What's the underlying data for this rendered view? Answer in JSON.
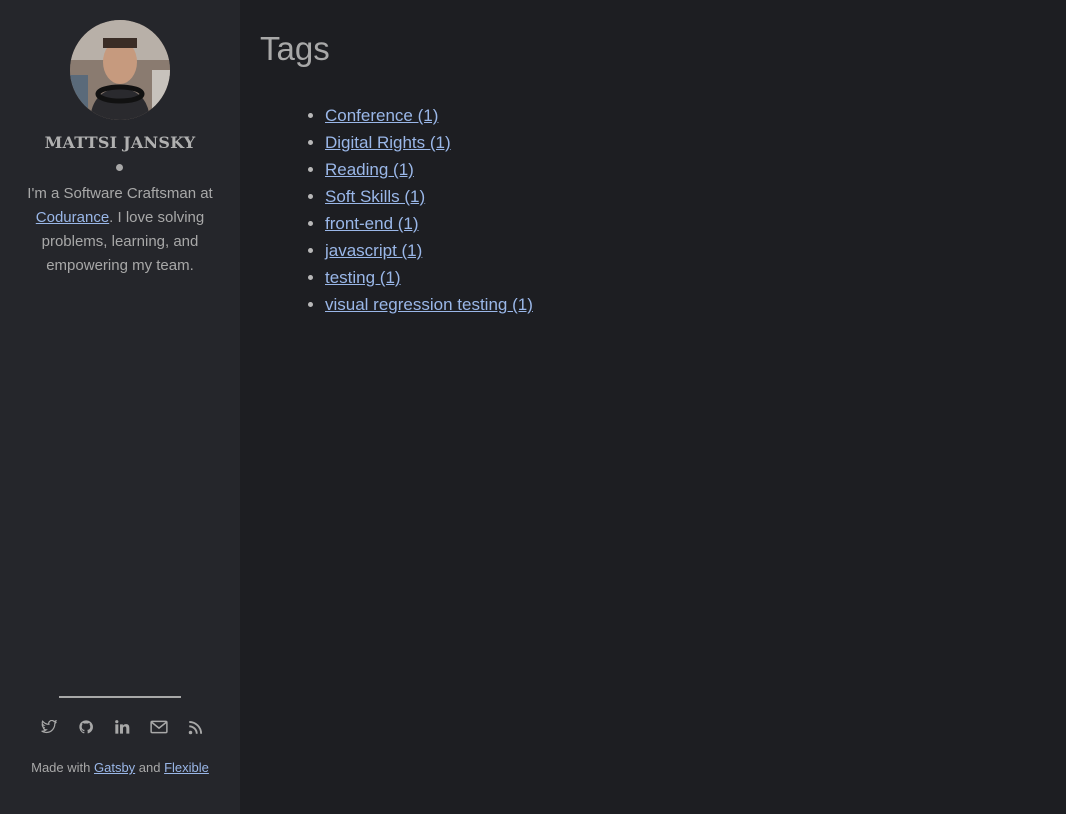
{
  "sidebar": {
    "author_name": "MATTSI JANSKY",
    "bio_prefix": "I'm a Software Craftsman at ",
    "bio_link": "Codurance",
    "bio_suffix": ". I love solving problems, learning, and empowering my team.",
    "social_icons": [
      "twitter-icon",
      "github-icon",
      "linkedin-icon",
      "mail-icon",
      "rss-icon"
    ],
    "credits": {
      "prefix": "Made with ",
      "link1": "Gatsby",
      "middle": " and ",
      "link2": "Flexible"
    }
  },
  "main": {
    "title": "Tags",
    "tags": [
      "Conference (1)",
      "Digital Rights (1)",
      "Reading (1)",
      "Soft Skills (1)",
      "front-end (1)",
      "javascript (1)",
      "testing (1)",
      "visual regression testing (1)"
    ]
  },
  "colors": {
    "background": "#1d1e22",
    "sidebar": "#25262b",
    "link": "#9ab7e8",
    "text": "#a8a8a8"
  }
}
